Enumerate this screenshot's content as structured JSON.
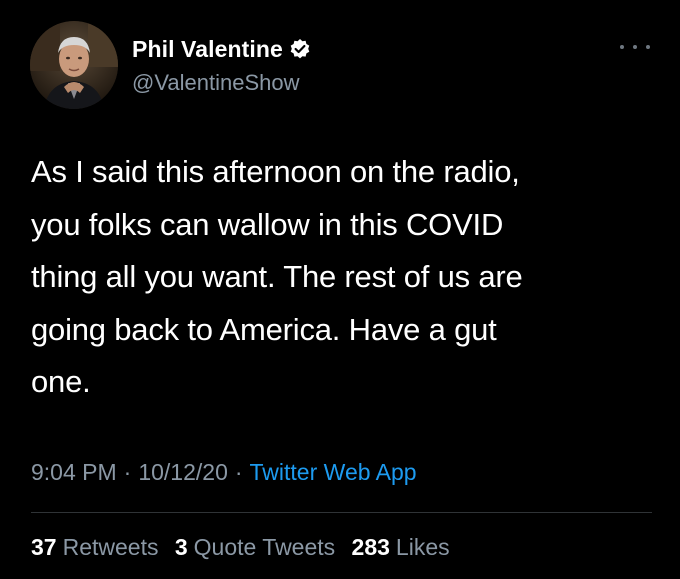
{
  "author": {
    "display_name": "Phil Valentine",
    "handle": "@ValentineShow",
    "verified_icon": "verified-badge-icon",
    "avatar_icon": "avatar-photo"
  },
  "more_icon": "more-options-icon",
  "tweet": {
    "lines": [
      "As I said this afternoon on the radio,",
      "you folks can wallow in this COVID",
      "thing all you want. The rest of us are",
      "going back to America. Have a gut",
      "one."
    ]
  },
  "meta": {
    "time": "9:04 PM",
    "separator": "·",
    "date": "10/12/20",
    "source": "Twitter Web App"
  },
  "stats": {
    "retweets_count": "37",
    "retweets_label": "Retweets",
    "quotes_count": "3",
    "quotes_label": "Quote Tweets",
    "likes_count": "283",
    "likes_label": "Likes"
  },
  "colors": {
    "background": "#000000",
    "text": "#ffffff",
    "secondary": "#8b98a5",
    "link": "#1d9bf0",
    "divider": "#2f3336"
  }
}
